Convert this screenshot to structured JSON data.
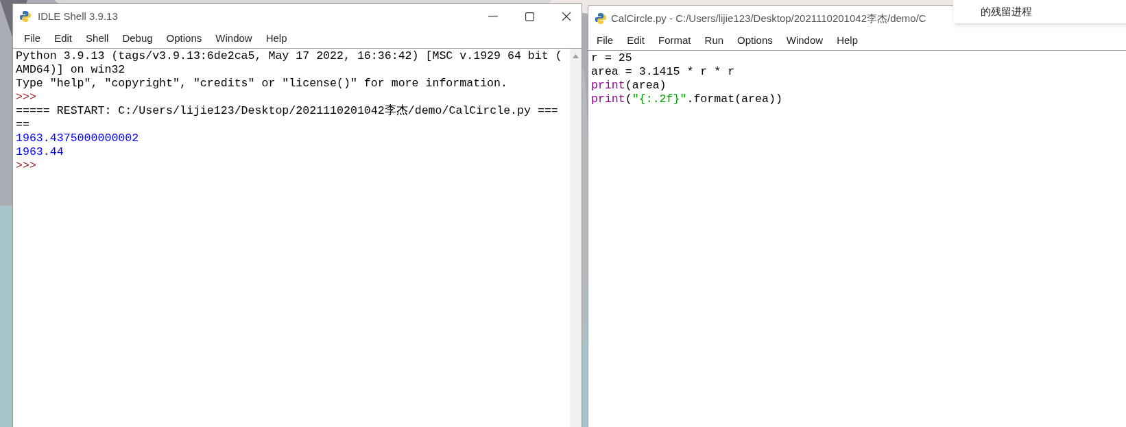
{
  "shell_window": {
    "title": "IDLE Shell 3.9.13",
    "menu": [
      "File",
      "Edit",
      "Shell",
      "Debug",
      "Options",
      "Window",
      "Help"
    ],
    "lines": [
      {
        "kind": "normal",
        "text": "Python 3.9.13 (tags/v3.9.13:6de2ca5, May 17 2022, 16:36:42) [MSC v.1929 64 bit ("
      },
      {
        "kind": "normal",
        "text": "AMD64)] on win32"
      },
      {
        "kind": "normal",
        "text": "Type \"help\", \"copyright\", \"credits\" or \"license()\" for more information."
      },
      {
        "kind": "prompt",
        "text": ">>>"
      },
      {
        "kind": "normal",
        "text": "===== RESTART: C:/Users/lijie123/Desktop/2021110201042李杰/demo/CalCircle.py ==="
      },
      {
        "kind": "normal",
        "text": "=="
      },
      {
        "kind": "output",
        "text": "1963.4375000000002"
      },
      {
        "kind": "output",
        "text": "1963.44"
      },
      {
        "kind": "prompt",
        "text": ">>>"
      }
    ]
  },
  "editor_window": {
    "title": "CalCircle.py - C:/Users/lijie123/Desktop/2021110201042李杰/demo/C",
    "menu": [
      "File",
      "Edit",
      "Format",
      "Run",
      "Options",
      "Window",
      "Help"
    ],
    "lines": [
      [
        {
          "kind": "plain",
          "text": "r = 25"
        }
      ],
      [
        {
          "kind": "plain",
          "text": "area = 3.1415 * r * r"
        }
      ],
      [
        {
          "kind": "builtin",
          "text": "print"
        },
        {
          "kind": "plain",
          "text": "(area)"
        }
      ],
      [
        {
          "kind": "builtin",
          "text": "print"
        },
        {
          "kind": "plain",
          "text": "("
        },
        {
          "kind": "string",
          "text": "\"{:.2f}\""
        },
        {
          "kind": "plain",
          "text": ".format(area))"
        }
      ]
    ]
  },
  "popup": {
    "text": "的残留进程"
  }
}
